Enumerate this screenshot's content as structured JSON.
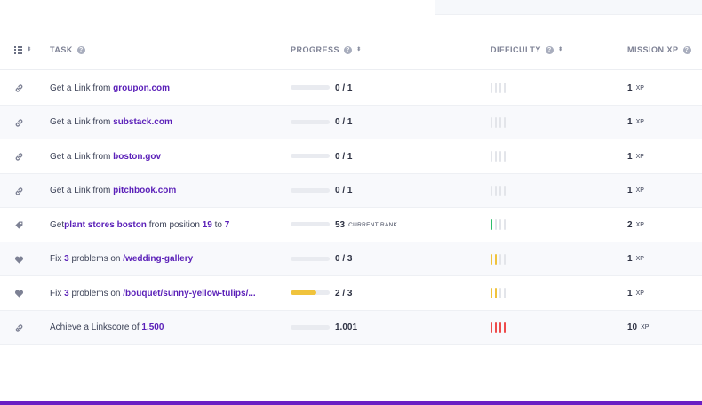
{
  "header": {
    "task": "TASK",
    "progress": "PROGRESS",
    "difficulty": "DIFFICULTY",
    "mission_xp": "MISSION XP",
    "help_glyph": "?",
    "sort_glyph": "⬍"
  },
  "rows": [
    {
      "icon": "link-icon",
      "task": {
        "pre": "Get a Link from ",
        "link": "groupon.com"
      },
      "progress": {
        "fraction": 0,
        "text": "0 / 1",
        "sub": ""
      },
      "difficulty": {
        "level": 0,
        "color": "#e3e5ea"
      },
      "xp": {
        "value": "1",
        "unit": "XP"
      }
    },
    {
      "icon": "link-icon",
      "task": {
        "pre": "Get a Link from ",
        "link": "substack.com"
      },
      "progress": {
        "fraction": 0,
        "text": "0 / 1",
        "sub": ""
      },
      "difficulty": {
        "level": 0,
        "color": "#e3e5ea"
      },
      "xp": {
        "value": "1",
        "unit": "XP"
      }
    },
    {
      "icon": "link-icon",
      "task": {
        "pre": "Get a Link from ",
        "link": "boston.gov"
      },
      "progress": {
        "fraction": 0,
        "text": "0 / 1",
        "sub": ""
      },
      "difficulty": {
        "level": 0,
        "color": "#e3e5ea"
      },
      "xp": {
        "value": "1",
        "unit": "XP"
      }
    },
    {
      "icon": "link-icon",
      "task": {
        "pre": "Get a Link from ",
        "link": "pitchbook.com"
      },
      "progress": {
        "fraction": 0,
        "text": "0 / 1",
        "sub": ""
      },
      "difficulty": {
        "level": 0,
        "color": "#e3e5ea"
      },
      "xp": {
        "value": "1",
        "unit": "XP"
      }
    },
    {
      "icon": "tag-icon",
      "task": {
        "pre": "Get ",
        "link": "plant stores boston",
        "mid": " from position ",
        "num1": "19",
        "mid2": " to ",
        "num2": "7"
      },
      "progress": {
        "fraction": 0,
        "text": "53",
        "sub": "CURRENT RANK"
      },
      "difficulty": {
        "level": 1,
        "color": "#2ebd6b"
      },
      "xp": {
        "value": "2",
        "unit": "XP"
      }
    },
    {
      "icon": "heart-icon",
      "task": {
        "pre": "Fix ",
        "num1": "3",
        "mid": " problems on ",
        "link": "/wedding-gallery"
      },
      "progress": {
        "fraction": 0,
        "text": "0 / 3",
        "sub": ""
      },
      "difficulty": {
        "level": 2,
        "color": "#f0c33c"
      },
      "xp": {
        "value": "1",
        "unit": "XP"
      }
    },
    {
      "icon": "heart-icon",
      "task": {
        "pre": "Fix ",
        "num1": "3",
        "mid": " problems on ",
        "link": "/bouquet/sunny-yellow-tulips/..."
      },
      "progress": {
        "fraction": 0.6667,
        "text": "2 / 3",
        "sub": ""
      },
      "difficulty": {
        "level": 2,
        "color": "#f0c33c"
      },
      "xp": {
        "value": "1",
        "unit": "XP"
      }
    },
    {
      "icon": "link-icon",
      "task": {
        "pre": "Achieve a Linkscore of ",
        "link": "1.500"
      },
      "progress": {
        "fraction": 0,
        "text": "1.001",
        "sub": ""
      },
      "difficulty": {
        "level": 4,
        "color": "#ee4b4b"
      },
      "xp": {
        "value": "10",
        "unit": "XP"
      }
    }
  ],
  "colors": {
    "accent": "#5a1fb8",
    "bottom_bar": "#6a1fc4",
    "progress_fill": "#f0c33c"
  }
}
